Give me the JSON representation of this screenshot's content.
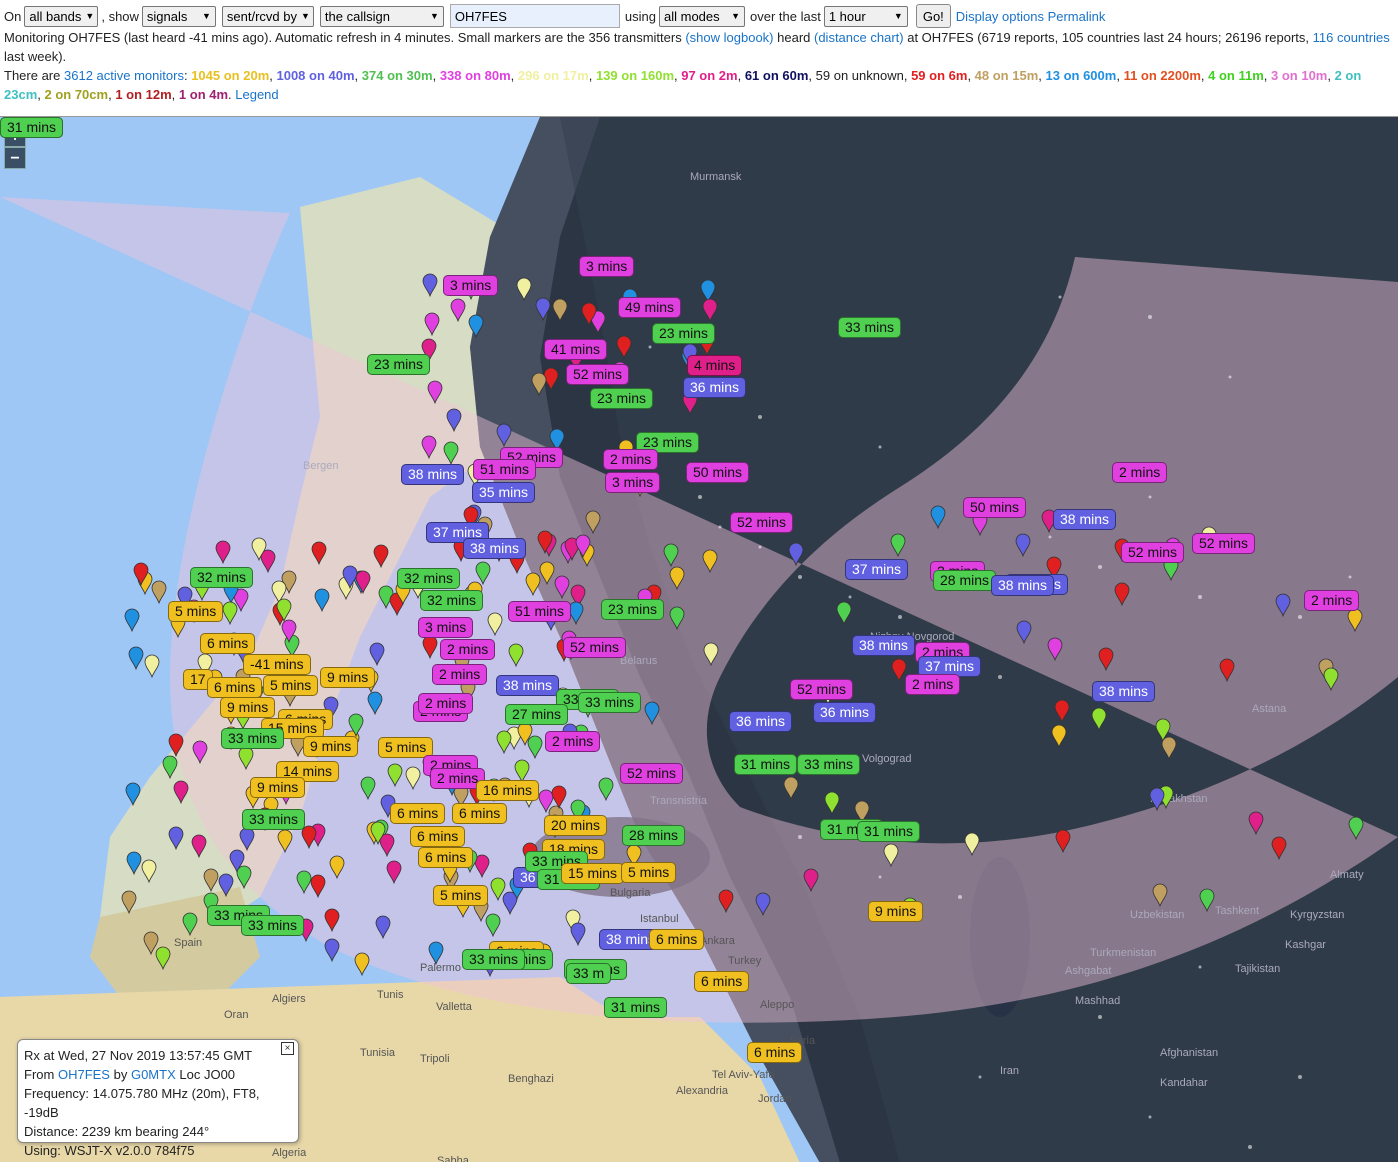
{
  "controls": {
    "on_label": "On",
    "band_select": "all bands",
    "show_label": ", show",
    "show_select": "signals",
    "dir_select": "sent/rcvd by",
    "who_select": "the callsign",
    "callsign_value": "OH7FES",
    "using_label": "using",
    "mode_select": "all modes",
    "over_label": "over the last",
    "period_select": "1 hour",
    "go_label": "Go!",
    "display_options": "Display options",
    "permalink": "Permalink"
  },
  "status": {
    "part1": "Monitoring OH7FES (last heard -41 mins ago). Automatic refresh in 4 minutes. Small markers are the 356 transmitters",
    "show_logbook": "(show logbook)",
    "heard": "heard",
    "distance_chart": "(distance chart)",
    "part2": "at OH7FES (6719 reports, 105 countries last 24 hours; 26196 reports,",
    "countries_link": "116 countries",
    "part3": "last week)."
  },
  "monitors": {
    "prefix": "There are",
    "active_link": "3612 active monitors",
    "colon": ":",
    "bands": [
      {
        "text": "1045 on 20m",
        "color": "#e8c020"
      },
      {
        "text": "1008 on 40m",
        "color": "#6060e0"
      },
      {
        "text": "374 on 30m",
        "color": "#50c050"
      },
      {
        "text": "338 on 80m",
        "color": "#e040e0"
      },
      {
        "text": "296 on 17m",
        "color": "#f0f0a0"
      },
      {
        "text": "139 on 160m",
        "color": "#90e030"
      },
      {
        "text": "97 on 2m",
        "color": "#e0208a"
      },
      {
        "text": "61 on 60m",
        "color": "#101060"
      },
      {
        "text": "59 on unknown",
        "color": "#333333",
        "plain": true
      },
      {
        "text": "59 on 6m",
        "color": "#e02020"
      },
      {
        "text": "48 on 15m",
        "color": "#c0a060"
      },
      {
        "text": "13 on 600m",
        "color": "#2090e0"
      },
      {
        "text": "11 on 2200m",
        "color": "#e05020"
      },
      {
        "text": "4 on 11m",
        "color": "#40d020"
      },
      {
        "text": "3 on 10m",
        "color": "#e070d0"
      },
      {
        "text": "2 on 23cm",
        "color": "#40c0c0"
      },
      {
        "text": "2 on 70cm",
        "color": "#a0a020"
      },
      {
        "text": "1 on 12m",
        "color": "#b02020"
      },
      {
        "text": "1 on 4m",
        "color": "#a02070"
      }
    ],
    "legend": "Legend"
  },
  "map": {
    "zoom_in": "+",
    "zoom_out": "−",
    "places": [
      {
        "name": "Murmansk",
        "light": true
      },
      {
        "name": "Bergen",
        "light": true
      },
      {
        "name": "Belarus",
        "light": true
      },
      {
        "name": "Transnistria",
        "light": true
      },
      {
        "name": "Kazakhstan",
        "light": true
      },
      {
        "name": "Astana",
        "light": true
      },
      {
        "name": "Uzbekistan",
        "light": true
      },
      {
        "name": "Tashkent",
        "light": true
      },
      {
        "name": "Kyrgyzstan",
        "light": true
      },
      {
        "name": "Kashgar",
        "light": true
      },
      {
        "name": "Turkmenistan",
        "light": true
      },
      {
        "name": "Tajikistan",
        "light": true
      },
      {
        "name": "Ashgabat",
        "light": true
      },
      {
        "name": "Mashhad",
        "light": true
      },
      {
        "name": "Afghanistan",
        "light": true
      },
      {
        "name": "Kandahar",
        "light": true
      },
      {
        "name": "Iran",
        "light": true
      },
      {
        "name": "Almaty",
        "light": true
      },
      {
        "name": "Turkey",
        "light": false
      },
      {
        "name": "Ankara",
        "light": false
      },
      {
        "name": "Istanbul",
        "light": false
      },
      {
        "name": "Aleppo",
        "light": false
      },
      {
        "name": "Syria",
        "light": false
      },
      {
        "name": "Tel Aviv-Yafo",
        "light": false
      },
      {
        "name": "Jordan",
        "light": false
      },
      {
        "name": "Alexandria",
        "light": false
      },
      {
        "name": "Benghazi",
        "light": false
      },
      {
        "name": "Tripoli",
        "light": false
      },
      {
        "name": "Tunisia",
        "light": false
      },
      {
        "name": "Tunis",
        "light": false
      },
      {
        "name": "Algiers",
        "light": false
      },
      {
        "name": "Oran",
        "light": false
      },
      {
        "name": "Spain",
        "light": false
      },
      {
        "name": "Palermo",
        "light": false
      },
      {
        "name": "Valletta",
        "light": false
      },
      {
        "name": "Sabha",
        "light": false
      },
      {
        "name": "Algeria",
        "light": false
      },
      {
        "name": "Bulgaria",
        "light": false
      },
      {
        "name": "Nizhny Novgorod",
        "light": true
      },
      {
        "name": "Volgograd",
        "light": true
      }
    ],
    "labels": [
      {
        "text": "3 mins",
        "color": "#e040e0"
      },
      {
        "text": "3 mins",
        "color": "#e040e0"
      },
      {
        "text": "49 mins",
        "color": "#e040e0"
      },
      {
        "text": "23 mins",
        "color": "#50d050"
      },
      {
        "text": "33 mins",
        "color": "#50d050"
      },
      {
        "text": "41 mins",
        "color": "#e040e0"
      },
      {
        "text": "23 mins",
        "color": "#50d050"
      },
      {
        "text": "4 mins",
        "color": "#e0208a"
      },
      {
        "text": "52 mins",
        "color": "#e040e0"
      },
      {
        "text": "36 mins",
        "color": "#6060e0"
      },
      {
        "text": "23 mins",
        "color": "#50d050"
      },
      {
        "text": "52 mins",
        "color": "#e040e0"
      },
      {
        "text": "23 mins",
        "color": "#50d050"
      },
      {
        "text": "52 mins",
        "color": "#e040e0"
      },
      {
        "text": "2 mins",
        "color": "#e040e0"
      },
      {
        "text": "50 mins",
        "color": "#e040e0"
      },
      {
        "text": "38 mins",
        "color": "#6060e0"
      },
      {
        "text": "51 mins",
        "color": "#e040e0"
      },
      {
        "text": "35 mins",
        "color": "#6060e0"
      },
      {
        "text": "3 mins",
        "color": "#e040e0"
      },
      {
        "text": "2 mins",
        "color": "#e040e0"
      },
      {
        "text": "50 mins",
        "color": "#e040e0"
      },
      {
        "text": "38 mins",
        "color": "#6060e0"
      },
      {
        "text": "52 mins",
        "color": "#e040e0"
      },
      {
        "text": "37 mins",
        "color": "#6060e0"
      },
      {
        "text": "38 mins",
        "color": "#6060e0"
      },
      {
        "text": "38 mins",
        "color": "#6060e0"
      },
      {
        "text": "52 mins",
        "color": "#e040e0"
      },
      {
        "text": "2 mins",
        "color": "#e040e0"
      },
      {
        "text": "2 mins",
        "color": "#e040e0"
      },
      {
        "text": "28 mins",
        "color": "#50d050"
      },
      {
        "text": "37 mins",
        "color": "#6060e0"
      },
      {
        "text": "38 mins",
        "color": "#6060e0"
      },
      {
        "text": "2 mins",
        "color": "#e040e0"
      },
      {
        "text": "32 mins",
        "color": "#50d050"
      },
      {
        "text": "32 mins",
        "color": "#50d050"
      },
      {
        "text": "5 mins",
        "color": "#f0c020"
      },
      {
        "text": "32 mins",
        "color": "#50d050"
      },
      {
        "text": "51 mins",
        "color": "#e040e0"
      },
      {
        "text": "23 mins",
        "color": "#50d050"
      },
      {
        "text": "6 mins",
        "color": "#f0c020"
      },
      {
        "text": "3 mins",
        "color": "#e040e0"
      },
      {
        "text": "2 mins",
        "color": "#e040e0"
      },
      {
        "text": "52 mins",
        "color": "#e040e0"
      },
      {
        "text": "38 mins",
        "color": "#6060e0"
      },
      {
        "text": "37 mins",
        "color": "#6060e0"
      },
      {
        "text": "2 mins",
        "color": "#e040e0"
      },
      {
        "text": "38 mins",
        "color": "#6060e0"
      },
      {
        "text": "-41 mins",
        "color": "#f0c020"
      },
      {
        "text": "9 mins",
        "color": "#f0c020"
      },
      {
        "text": "2 mins",
        "color": "#e040e0"
      },
      {
        "text": "17",
        "color": "#f0c020"
      },
      {
        "text": "6 mins",
        "color": "#f0c020"
      },
      {
        "text": "5 mins",
        "color": "#f0c020"
      },
      {
        "text": "9 mins",
        "color": "#f0c020"
      },
      {
        "text": "2 mins",
        "color": "#e040e0"
      },
      {
        "text": "38 mins",
        "color": "#6060e0"
      },
      {
        "text": "33 mins",
        "color": "#50d050"
      },
      {
        "text": "52 mins",
        "color": "#e040e0"
      },
      {
        "text": "6 mins",
        "color": "#f0c020"
      },
      {
        "text": "2 mins",
        "color": "#e040e0"
      },
      {
        "text": "27 mins",
        "color": "#50d050"
      },
      {
        "text": "33 mins",
        "color": "#50d050"
      },
      {
        "text": "36 mins",
        "color": "#6060e0"
      },
      {
        "text": "36 mins",
        "color": "#6060e0"
      },
      {
        "text": "15 mins",
        "color": "#f0c020"
      },
      {
        "text": "33 mins",
        "color": "#50d050"
      },
      {
        "text": "9 mins",
        "color": "#f0c020"
      },
      {
        "text": "5 mins",
        "color": "#f0c020"
      },
      {
        "text": "2 mins",
        "color": "#e040e0"
      },
      {
        "text": "31 mins",
        "color": "#50d050"
      },
      {
        "text": "33 mins",
        "color": "#50d050"
      },
      {
        "text": "14 mins",
        "color": "#f0c020"
      },
      {
        "text": "2 mins",
        "color": "#e040e0"
      },
      {
        "text": "2 mins",
        "color": "#e040e0"
      },
      {
        "text": "52 mins",
        "color": "#e040e0"
      },
      {
        "text": "9 mins",
        "color": "#f0c020"
      },
      {
        "text": "16 mins",
        "color": "#f0c020"
      },
      {
        "text": "6 mins",
        "color": "#f0c020"
      },
      {
        "text": "6 mins",
        "color": "#f0c020"
      },
      {
        "text": "33 mins",
        "color": "#50d050"
      },
      {
        "text": "31 mins",
        "color": "#50d050"
      },
      {
        "text": "20 mins",
        "color": "#f0c020"
      },
      {
        "text": "31 mins",
        "color": "#50d050"
      },
      {
        "text": "28 mins",
        "color": "#50d050"
      },
      {
        "text": "6 mins",
        "color": "#f0c020"
      },
      {
        "text": "6 mins",
        "color": "#f0c020"
      },
      {
        "text": "18 mins",
        "color": "#f0c020"
      },
      {
        "text": "36 mins",
        "color": "#6060e0"
      },
      {
        "text": "33 mins",
        "color": "#50d050"
      },
      {
        "text": "31 mins",
        "color": "#50d050"
      },
      {
        "text": "15 mins",
        "color": "#f0c020"
      },
      {
        "text": "5 mins",
        "color": "#f0c020"
      },
      {
        "text": "5 mins",
        "color": "#f0c020"
      },
      {
        "text": "9 mins",
        "color": "#f0c020"
      },
      {
        "text": "6 mins",
        "color": "#f0c020"
      },
      {
        "text": "38 mins",
        "color": "#6060e0"
      },
      {
        "text": "33 mins",
        "color": "#50d050"
      },
      {
        "text": "33 mins",
        "color": "#50d050"
      },
      {
        "text": "6 mins",
        "color": "#f0c020"
      },
      {
        "text": "33 mins",
        "color": "#50d050"
      },
      {
        "text": "32 mins",
        "color": "#50d050"
      },
      {
        "text": "33 mins",
        "color": "#50d050"
      },
      {
        "text": "33 m",
        "color": "#50d050"
      },
      {
        "text": "31 mins",
        "color": "#50d050"
      },
      {
        "text": "6 mins",
        "color": "#f0c020"
      },
      {
        "text": "6 mins",
        "color": "#f0c020"
      },
      {
        "text": "33 mins",
        "color": "#50d050"
      },
      {
        "text": "33 mins",
        "color": "#50d050"
      },
      {
        "text": "31 mins",
        "color": "#50d050"
      }
    ]
  },
  "info": {
    "rx_line": "Rx at Wed, 27 Nov 2019 13:57:45 GMT",
    "from_label": "From",
    "from_call": "OH7FES",
    "by_label": "by",
    "by_call": "G0MTX",
    "loc": "Loc JO00",
    "frequency": "Frequency: 14.075.780 MHz (20m), FT8, -19dB",
    "distance": "Distance: 2239 km bearing 244°",
    "using": "Using: WSJT-X v2.0.0 784f75",
    "close": "×"
  }
}
